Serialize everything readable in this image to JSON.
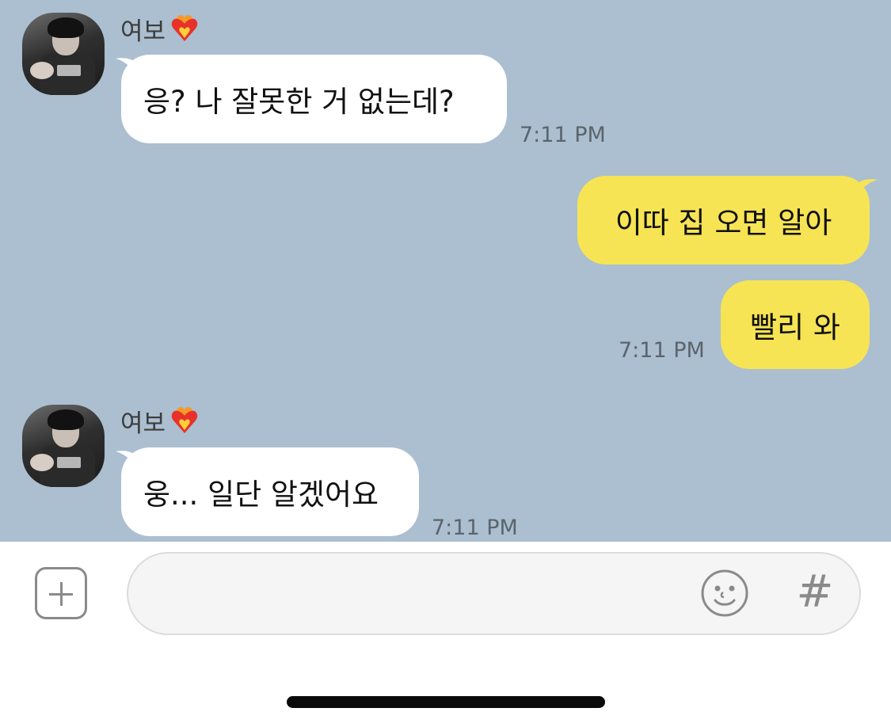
{
  "messages": [
    {
      "sender": "여보",
      "direction": "incoming",
      "text": "응? 나 잘못한 거 없는데?",
      "time": "7:11 PM"
    },
    {
      "direction": "outgoing",
      "text": "이따 집 오면 알아",
      "time": ""
    },
    {
      "direction": "outgoing",
      "text": "빨리 와",
      "time": "7:11 PM"
    },
    {
      "sender": "여보",
      "direction": "incoming",
      "text": "웅... 일단 알겠어요",
      "time": "7:11 PM"
    }
  ],
  "composer": {
    "input_value": "",
    "add_icon": "plus-square-icon",
    "emoji_icon": "smiley-icon",
    "hash_label": "#"
  },
  "colors": {
    "chat_background": "#abbfd0",
    "incoming_bubble": "#ffffff",
    "outgoing_bubble": "#f7e454"
  }
}
